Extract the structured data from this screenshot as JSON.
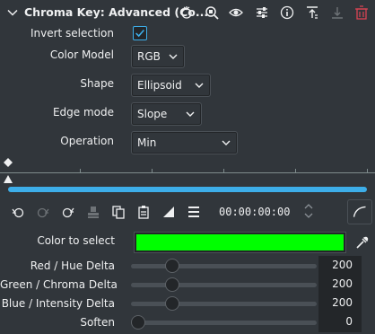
{
  "header": {
    "title": "Chroma Key: Advanced (Co...",
    "icons": [
      "chevron-down-icon",
      "reset-icon",
      "zoom-icon",
      "eye-icon",
      "settings-icon",
      "info-icon",
      "collapse-icon",
      "move-down-icon",
      "delete-icon"
    ]
  },
  "form": {
    "invert_selection_label": "Invert selection",
    "invert_selection_checked": true,
    "color_model_label": "Color Model",
    "color_model_value": "RGB",
    "shape_label": "Shape",
    "shape_value": "Ellipsoid",
    "edge_mode_label": "Edge mode",
    "edge_mode_value": "Slope",
    "operation_label": "Operation",
    "operation_value": "Min"
  },
  "toolbar": {
    "timecode": "00:00:00:00",
    "icons": [
      "undo-keyframe-icon",
      "redo-keyframe-icon",
      "reset-keyframe-icon",
      "stamp-icon",
      "copy-icon",
      "paste-icon",
      "ramp-icon",
      "list-icon",
      "spinner-icon",
      "curve-icon"
    ]
  },
  "color_select": {
    "label": "Color to select",
    "color": "#00ff00"
  },
  "sliders": [
    {
      "label": "Red / Hue Delta",
      "value": "200",
      "fraction": 0.2
    },
    {
      "label": "Green / Chroma Delta",
      "value": "200",
      "fraction": 0.2
    },
    {
      "label": "Blue / Intensity Delta",
      "value": "200",
      "fraction": 0.2
    },
    {
      "label": "Soften",
      "value": "0",
      "fraction": 0.0
    }
  ],
  "colors": {
    "accent": "#3daee9",
    "background": "#31363b",
    "field": "#232629",
    "text": "#eff0f1"
  }
}
